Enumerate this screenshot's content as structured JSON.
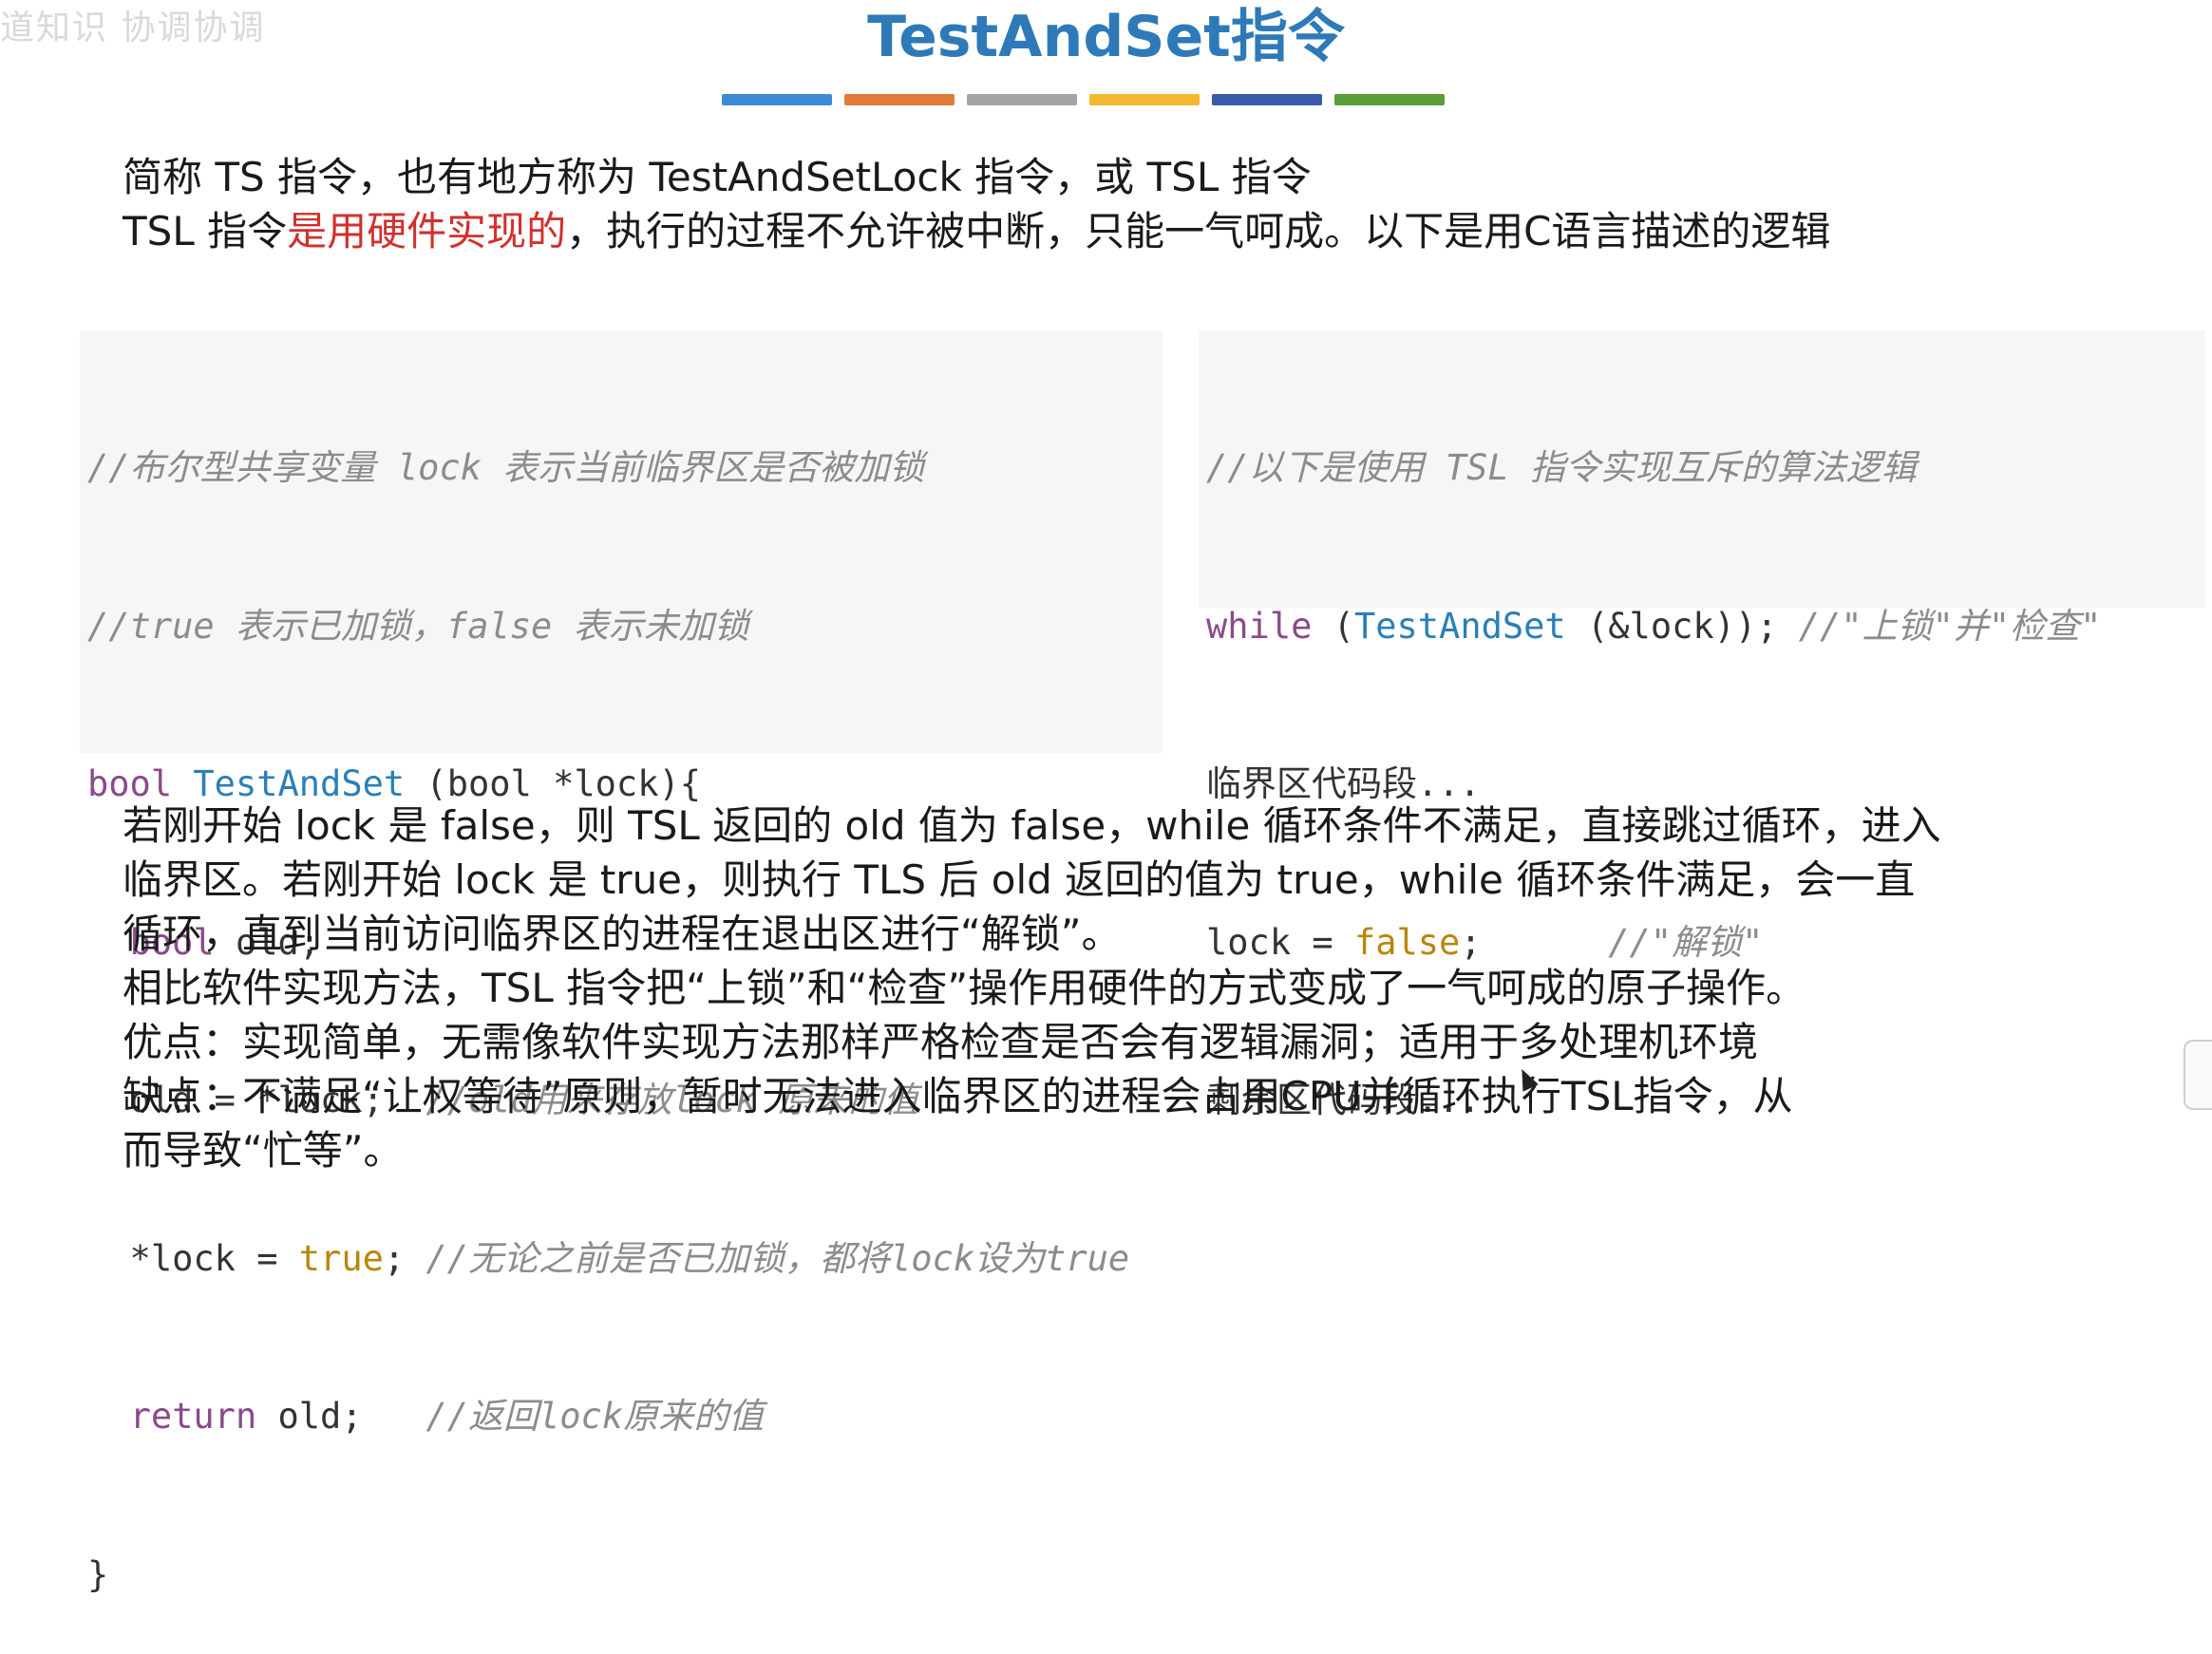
{
  "watermark": "道知识 协调协调",
  "title": "TestAndSet指令",
  "color_bar": [
    "#3d8bd4",
    "#e07b39",
    "#a5a5a5",
    "#f2b830",
    "#3a5ba9",
    "#5a9e3a"
  ],
  "intro": {
    "line1": "简称 TS 指令，也有地方称为 TestAndSetLock 指令，或 TSL 指令",
    "line2_a": "TSL 指令",
    "line2_red": "是用硬件实现的",
    "line2_b": "，执行的过程不允许被中断，只能一气呵成。以下是用C语言描述的逻辑"
  },
  "code_left": {
    "l1": "//布尔型共享变量 lock 表示当前临界区是否被加锁",
    "l2": "//true 表示已加锁，false 表示未加锁",
    "l3_kw": "bool",
    "l3_fn": "TestAndSet",
    "l3_rest": " (bool *lock){",
    "l4_kw": "bool",
    "l4_rest": " old;",
    "l5_code": "  old = *lock;  ",
    "l5_cm": "//old用来存放lock 原来的值",
    "l6_code": "  *lock = ",
    "l6_val": "true",
    "l6_semi": "; ",
    "l6_cm": "//无论之前是否已加锁，都将lock设为true",
    "l7_kw": "return",
    "l7_code": " old;   ",
    "l7_cm": "//返回lock原来的值",
    "l8": "}"
  },
  "code_right": {
    "l1": "//以下是使用 TSL 指令实现互斥的算法逻辑",
    "l2_kw": "while",
    "l2_fn": "TestAndSet",
    "l2_rest": " (&lock)); ",
    "l2_cm": "//\"上锁\"并\"检查\"",
    "l3": "临界区代码段...",
    "l4_code": "lock = ",
    "l4_val": "false",
    "l4_semi": ";      ",
    "l4_cm": "//\"解锁\"",
    "l5": "剩余区代码段..."
  },
  "explain": {
    "p1": "若刚开始 lock 是 false，则 TSL 返回的 old 值为 false，while 循环条件不满足，直接跳过循环，进入",
    "p2": "临界区。若刚开始 lock 是 true，则执行 TLS 后 old 返回的值为 true，while 循环条件满足，会一直",
    "p3": "循环，直到当前访问临界区的进程在退出区进行“解锁”。",
    "p4": "相比软件实现方法，TSL 指令把“上锁”和“检查”操作用硬件的方式变成了一气呵成的原子操作。",
    "p5": "优点：实现简单，无需像软件实现方法那样严格检查是否会有逻辑漏洞；适用于多处理机环境",
    "p6": "缺点：不满足“让权等待”原则，暂时无法进入临界区的进程会占用CPU并循环执行TSL指令，从",
    "p7": "而导致“忙等”。"
  }
}
